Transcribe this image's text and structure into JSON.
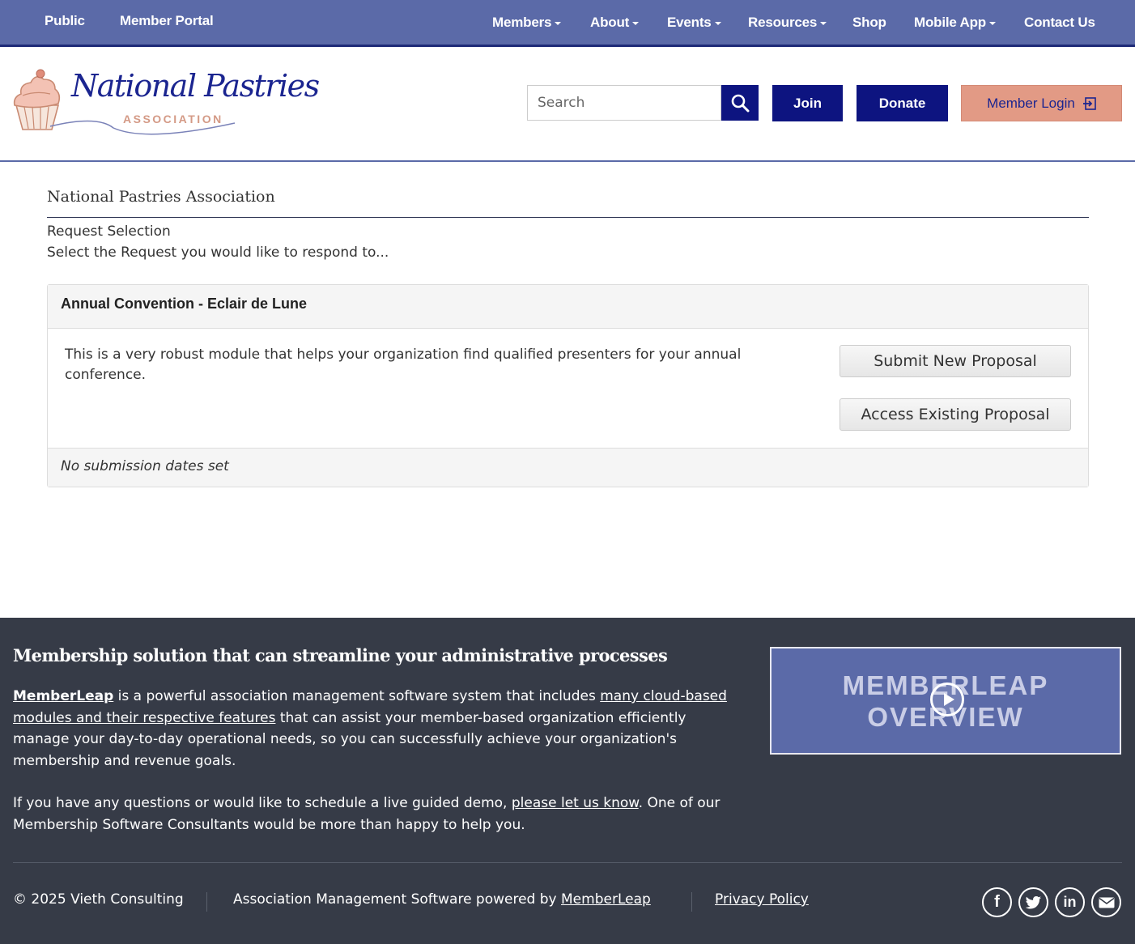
{
  "topbar": {
    "left_links": [
      "Public",
      "Member Portal"
    ],
    "nav": {
      "members": "Members",
      "about": "About",
      "events": "Events",
      "resources": "Resources",
      "shop": "Shop",
      "mobile_app": "Mobile App",
      "contact": "Contact Us"
    }
  },
  "header": {
    "logo": {
      "line1": "National Pastries",
      "line2": "ASSOCIATION"
    },
    "search_placeholder": "Search",
    "join_label": "Join",
    "donate_label": "Donate",
    "login_label": "Member Login"
  },
  "main": {
    "org_title": "National Pastries Association",
    "request_label": "Request Selection",
    "instructions": "Select the Request you would like to respond to...",
    "request": {
      "title": "Annual Convention - Eclair de Lune",
      "description": "This is a very robust module that helps your organization find qualified presenters for your annual conference.",
      "submit_label": "Submit New Proposal",
      "access_label": "Access Existing Proposal",
      "dates_note": "No submission dates set"
    }
  },
  "footer": {
    "heading": "Membership solution that can streamline your administrative processes",
    "p1": {
      "brand": "MemberLeap",
      "t1": " is a powerful association management software system that includes ",
      "link": "many cloud-based modules and their respective features",
      "t2": " that can assist your member-based organization efficiently manage your day-to-day operational needs, so you can successfully achieve your organization's membership and revenue goals."
    },
    "p2": {
      "t1": "If you have any questions or would like to schedule a live guided demo, ",
      "link": "please let us know",
      "t2": ". One of our Membership Software Consultants would be more than happy to help you."
    },
    "video": {
      "line1": "MEMBERLEAP",
      "line2": "OVERVIEW"
    },
    "copyright": "© 2025 Vieth Consulting",
    "powered_text": "Association Management Software powered by ",
    "powered_link": "MemberLeap",
    "privacy": "Privacy Policy",
    "social": [
      "facebook-icon",
      "twitter-icon",
      "linkedin-icon",
      "email-icon"
    ]
  },
  "colors": {
    "topbar": "#5b6aa8",
    "navy": "#0d1480",
    "login": "#e29a85",
    "footer": "#363b47"
  }
}
